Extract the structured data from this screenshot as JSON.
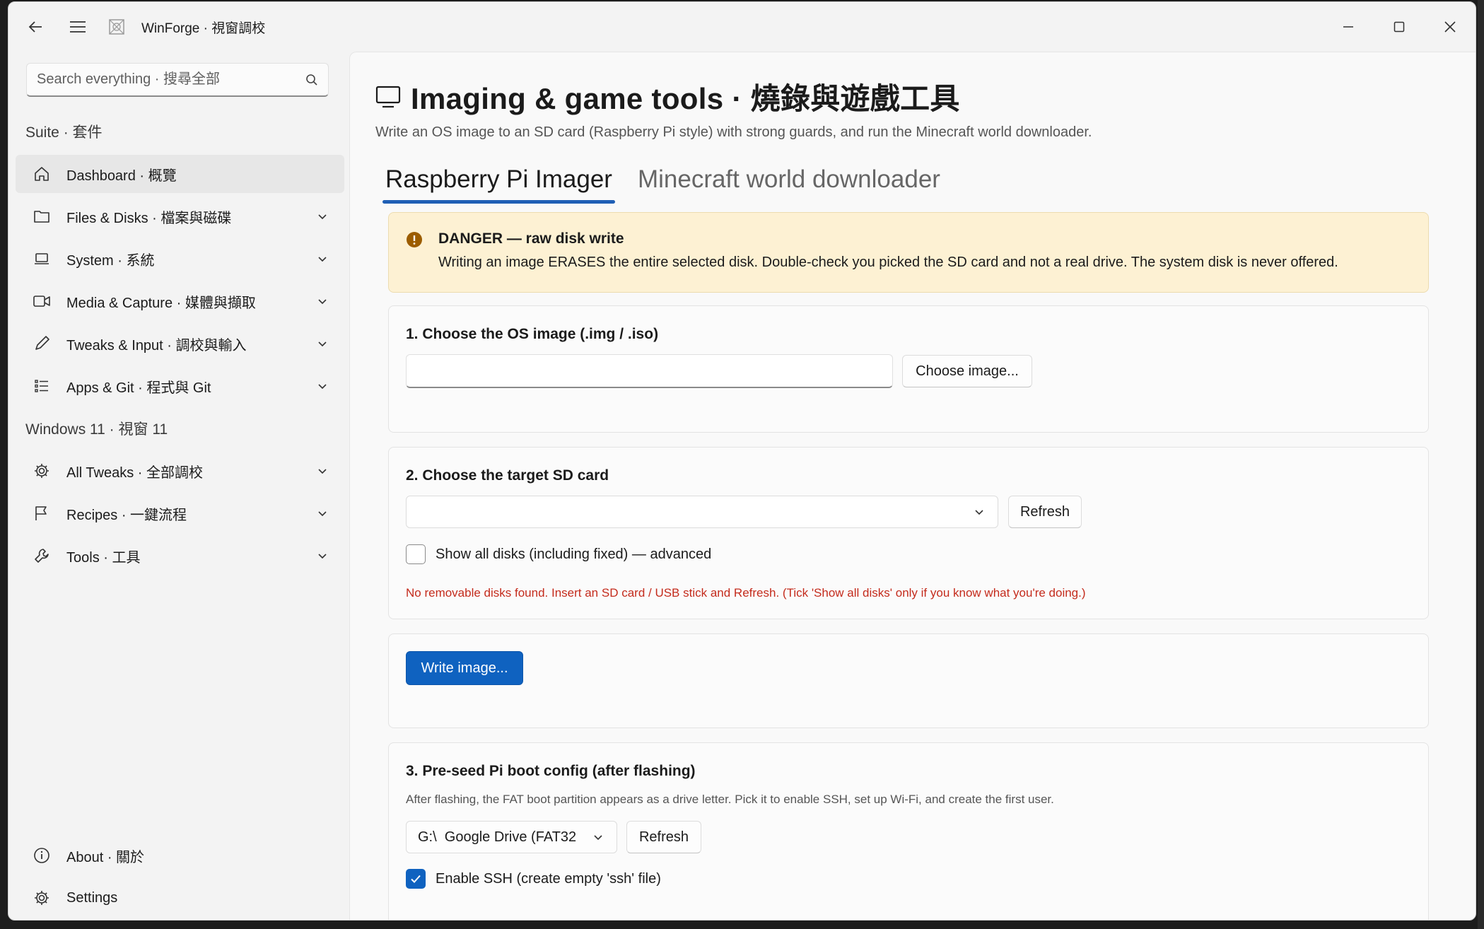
{
  "window": {
    "app_title": "WinForge · 視窗調校"
  },
  "sidebar": {
    "search_placeholder": "Search everything · 搜尋全部",
    "section_suite": "Suite · 套件",
    "section_windows": "Windows 11 · 視窗 11",
    "items": [
      {
        "label": "Dashboard · 概覽",
        "icon": "home-icon"
      },
      {
        "label": "Files & Disks · 檔案與磁碟",
        "icon": "folder-icon"
      },
      {
        "label": "System · 系統",
        "icon": "laptop-icon"
      },
      {
        "label": "Media & Capture · 媒體與擷取",
        "icon": "video-icon"
      },
      {
        "label": "Tweaks & Input · 調校與輸入",
        "icon": "pen-icon"
      },
      {
        "label": "Apps & Git · 程式與 Git",
        "icon": "list-icon"
      },
      {
        "label": "All Tweaks · 全部調校",
        "icon": "gear-icon"
      },
      {
        "label": "Recipes · 一鍵流程",
        "icon": "flag-icon"
      },
      {
        "label": "Tools · 工具",
        "icon": "wrench-icon"
      }
    ],
    "footer": {
      "about": "About · 關於",
      "settings": "Settings"
    }
  },
  "page": {
    "title": "Imaging & game tools · 燒錄與遊戲工具",
    "subtitle": "Write an OS image to an SD card (Raspberry Pi style) with strong guards, and run the Minecraft world downloader.",
    "tabs": [
      {
        "label": "Raspberry Pi Imager",
        "active": true
      },
      {
        "label": "Minecraft world downloader",
        "active": false
      }
    ]
  },
  "danger": {
    "title": "DANGER — raw disk write",
    "message": "Writing an image ERASES the entire selected disk. Double-check you picked the SD card and not a real drive. The system disk is never offered."
  },
  "step1": {
    "heading": "1. Choose the OS image (.img / .iso)",
    "path_value": "",
    "choose_button": "Choose image..."
  },
  "step2": {
    "heading": "2. Choose the target SD card",
    "selected_disk": "",
    "refresh_button": "Refresh",
    "show_all_label": "Show all disks (including fixed) — advanced",
    "show_all_checked": false,
    "error": "No removable disks found. Insert an SD card / USB stick and Refresh. (Tick 'Show all disks' only if you know what you're doing.)"
  },
  "write": {
    "button": "Write image..."
  },
  "step3": {
    "heading": "3. Pre-seed Pi boot config (after flashing)",
    "hint": "After flashing, the FAT boot partition appears as a drive letter. Pick it to enable SSH, set up Wi-Fi, and create the first user.",
    "drive_value": "G:\\  Google Drive (FAT32",
    "refresh_button": "Refresh",
    "ssh_label": "Enable SSH (create empty 'ssh' file)",
    "ssh_checked": true
  },
  "colors": {
    "accent": "#0f62c0",
    "danger_bg": "#fdf1d3",
    "error": "#c42b1c",
    "warning_icon": "#9c5d00"
  }
}
